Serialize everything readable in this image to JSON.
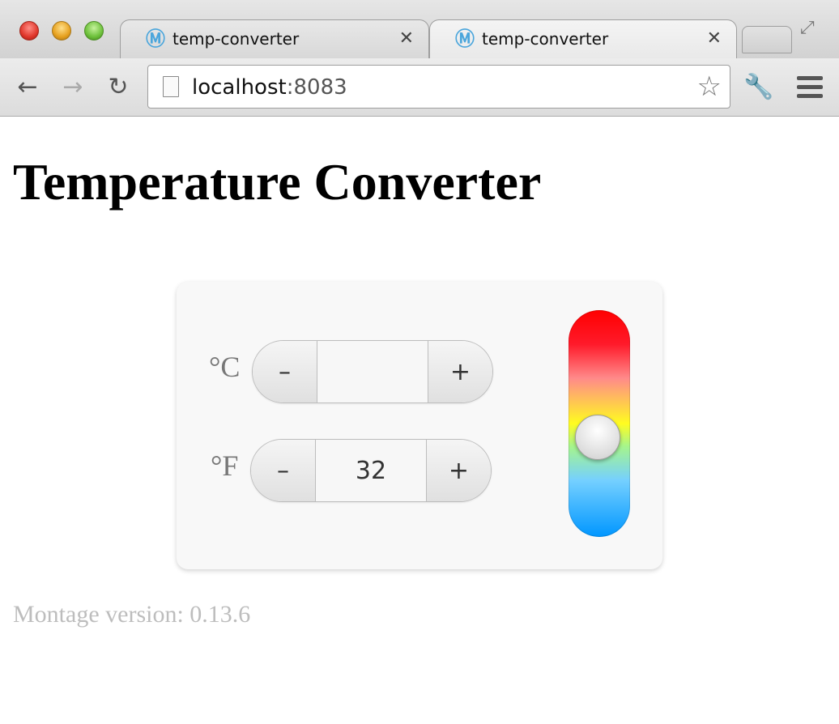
{
  "browser": {
    "tabs": [
      {
        "title": "temp-converter",
        "active": false
      },
      {
        "title": "temp-converter",
        "active": true
      }
    ],
    "url_host": "localhost",
    "url_port": ":8083"
  },
  "page": {
    "title": "Temperature Converter",
    "celsius": {
      "label": "°C",
      "value": "",
      "minus": "–",
      "plus": "+"
    },
    "fahrenheit": {
      "label": "°F",
      "value": "32",
      "minus": "–",
      "plus": "+"
    },
    "thermometer": {
      "level_fraction": 0.42
    },
    "version": "Montage version: 0.13.6"
  }
}
